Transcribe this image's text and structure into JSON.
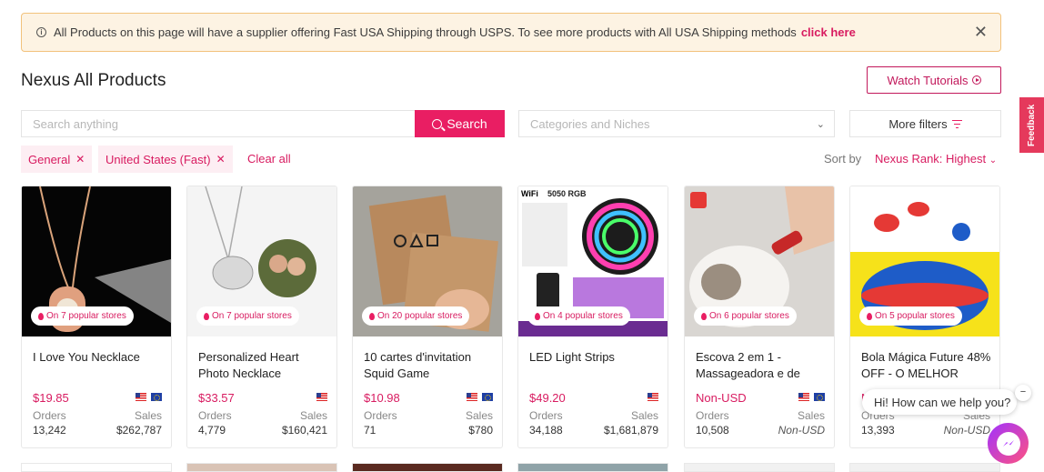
{
  "banner": {
    "text": "All Products on this page will have a supplier offering Fast USA Shipping through USPS. To see more products with All USA Shipping methods",
    "link": "click here",
    "close": "✕"
  },
  "page": {
    "title": "Nexus All Products"
  },
  "toolbar": {
    "watch_tutorials": "Watch Tutorials",
    "search_placeholder": "Search anything",
    "search_button": "Search",
    "categories_placeholder": "Categories and Niches",
    "more_filters": "More filters"
  },
  "filters": {
    "chips": [
      "General",
      "United States (Fast)"
    ],
    "clear_all": "Clear all",
    "sort_label": "Sort by",
    "sort_value": "Nexus Rank: Highest"
  },
  "feedback": "Feedback",
  "labels": {
    "orders": "Orders",
    "sales": "Sales"
  },
  "products": [
    {
      "name": "I Love You Necklace",
      "price": "$19.85",
      "stores": "On 7 popular stores",
      "orders": "13,242",
      "sales": "$262,787",
      "flags": [
        "us",
        "eu"
      ]
    },
    {
      "name": "Personalized Heart Photo Necklace",
      "price": "$33.57",
      "stores": "On 7 popular stores",
      "orders": "4,779",
      "sales": "$160,421",
      "flags": [
        "us"
      ]
    },
    {
      "name": "10 cartes d'invitation Squid Game",
      "price": "$10.98",
      "stores": "On 20 popular stores",
      "orders": "71",
      "sales": "$780",
      "flags": [
        "us",
        "eu"
      ]
    },
    {
      "name": "LED Light Strips",
      "price": "$49.20",
      "stores": "On 4 popular stores",
      "orders": "34,188",
      "sales": "$1,681,879",
      "flags": [
        "us"
      ]
    },
    {
      "name": "Escova 2 em 1 - Massageadora e de",
      "price": "Non-USD",
      "stores": "On 6 popular stores",
      "orders": "10,508",
      "sales": "Non-USD",
      "flags": [
        "us",
        "eu"
      ]
    },
    {
      "name": "Bola Mágica Future 48% OFF - O MELHOR",
      "price": "N",
      "stores": "On 5 popular stores",
      "orders": "13,393",
      "sales": "Non-USD",
      "flags": []
    }
  ],
  "chat": {
    "message": "Hi! How can we help you?",
    "close": "−"
  },
  "image_text": {
    "wifi": "WiFi",
    "rgb": "5050 RGB"
  }
}
